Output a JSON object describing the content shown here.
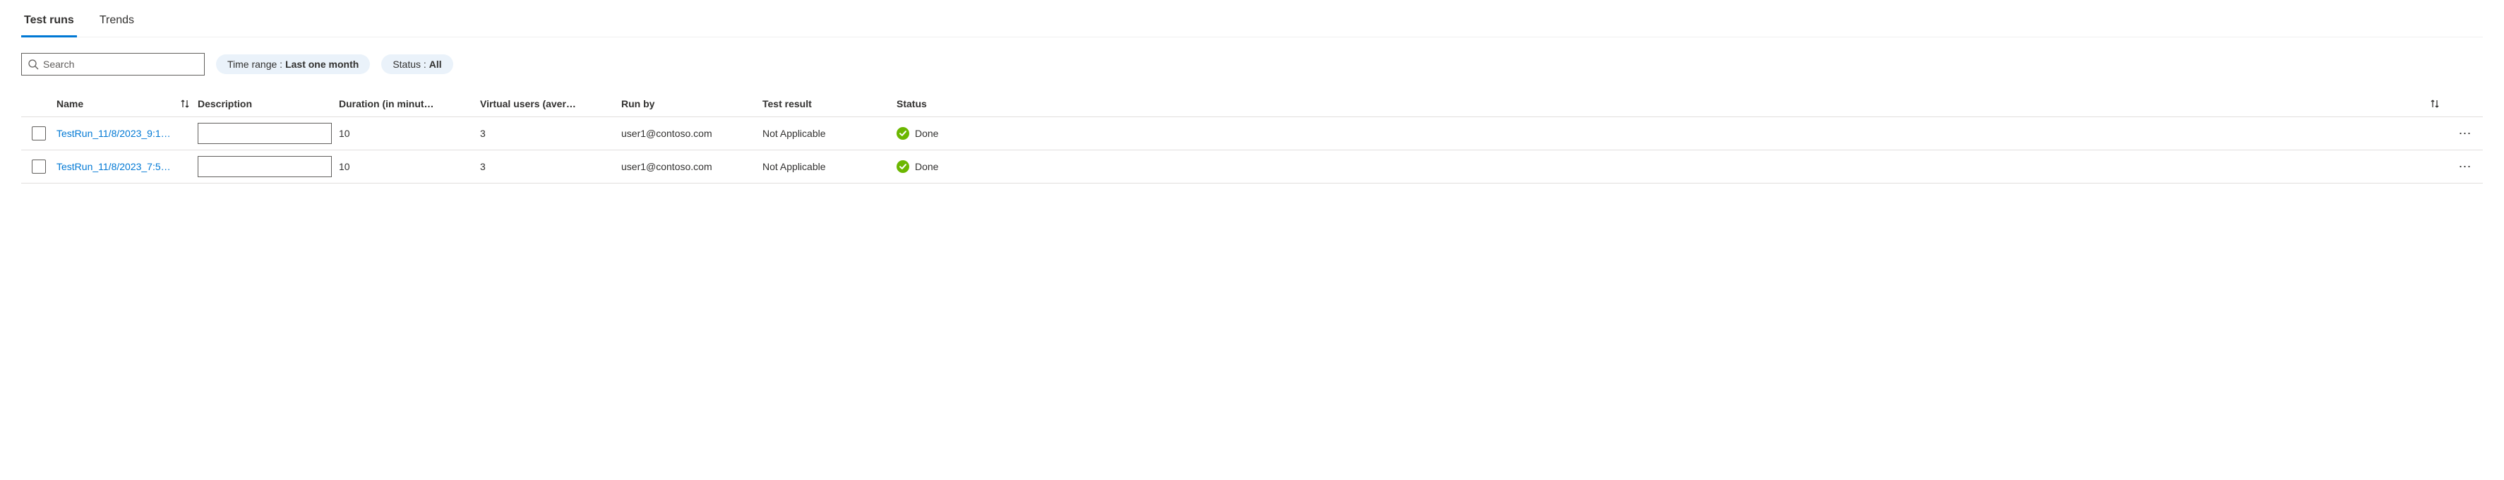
{
  "tabs": {
    "test_runs": "Test runs",
    "trends": "Trends"
  },
  "search": {
    "placeholder": "Search"
  },
  "filters": {
    "time_range_label": "Time range : ",
    "time_range_value": "Last one month",
    "status_label": "Status : ",
    "status_value": "All"
  },
  "columns": {
    "name": "Name",
    "description": "Description",
    "duration": "Duration (in minut…",
    "virtual_users": "Virtual users (aver…",
    "run_by": "Run by",
    "test_result": "Test result",
    "status": "Status"
  },
  "rows": [
    {
      "name": "TestRun_11/8/2023_9:1…",
      "description": "",
      "duration": "10",
      "virtual_users": "3",
      "run_by": "user1@contoso.com",
      "test_result": "Not Applicable",
      "status": "Done"
    },
    {
      "name": "TestRun_11/8/2023_7:5…",
      "description": "",
      "duration": "10",
      "virtual_users": "3",
      "run_by": "user1@contoso.com",
      "test_result": "Not Applicable",
      "status": "Done"
    }
  ]
}
